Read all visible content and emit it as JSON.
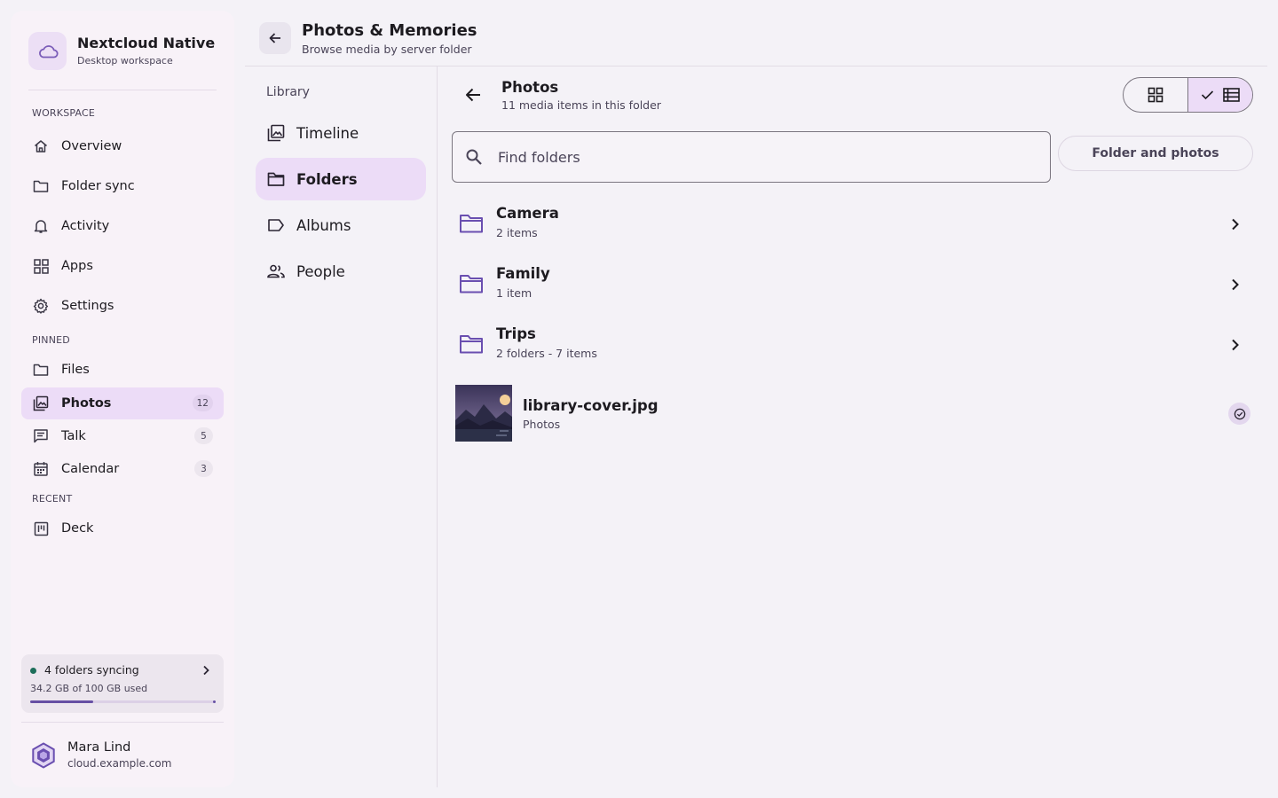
{
  "app": {
    "name": "Nextcloud Native",
    "subtitle": "Desktop workspace"
  },
  "sidebar": {
    "workspace_label": "WORKSPACE",
    "workspace_items": [
      {
        "label": "Overview",
        "icon": "home-icon"
      },
      {
        "label": "Folder sync",
        "icon": "folder-icon"
      },
      {
        "label": "Activity",
        "icon": "bell-icon"
      },
      {
        "label": "Apps",
        "icon": "apps-grid-icon"
      },
      {
        "label": "Settings",
        "icon": "gear-icon"
      }
    ],
    "pinned_label": "PINNED",
    "pinned_items": [
      {
        "label": "Files",
        "icon": "folder-icon",
        "badge": ""
      },
      {
        "label": "Photos",
        "icon": "photo-library-icon",
        "badge": "12",
        "active": true
      },
      {
        "label": "Talk",
        "icon": "chat-icon",
        "badge": "5"
      },
      {
        "label": "Calendar",
        "icon": "calendar-icon",
        "badge": "3"
      }
    ],
    "recent_label": "RECENT",
    "recent_items": [
      {
        "label": "Deck",
        "icon": "deck-board-icon"
      }
    ],
    "sync": {
      "title": "4 folders syncing",
      "usage": "34.2 GB of 100 GB used",
      "used_fraction": 0.342,
      "status_color": "#1d6e5a"
    },
    "user": {
      "name": "Mara Lind",
      "server": "cloud.example.com"
    }
  },
  "header": {
    "title": "Photos & Memories",
    "subtitle": "Browse media by server folder"
  },
  "library": {
    "title": "Library",
    "items": [
      {
        "label": "Timeline",
        "icon": "photo-library-icon"
      },
      {
        "label": "Folders",
        "icon": "folder-icon",
        "active": true
      },
      {
        "label": "Albums",
        "icon": "label-icon"
      },
      {
        "label": "People",
        "icon": "people-icon"
      }
    ]
  },
  "main": {
    "folder_title": "Photos",
    "folder_subtitle": "11 media items in this folder",
    "view_mode": "list",
    "search_placeholder": "Find folders",
    "search_value": "",
    "filter_label": "Folder and photos",
    "folders": [
      {
        "name": "Camera",
        "meta": "2 items"
      },
      {
        "name": "Family",
        "meta": "1 item"
      },
      {
        "name": "Trips",
        "meta": "2 folders - 7 items"
      }
    ],
    "media": [
      {
        "name": "library-cover.jpg",
        "meta": "Photos",
        "selected": true
      }
    ]
  },
  "colors": {
    "accent": "#6750a4",
    "active_bg": "#ecdcf7",
    "background": "#f4f2f7"
  }
}
